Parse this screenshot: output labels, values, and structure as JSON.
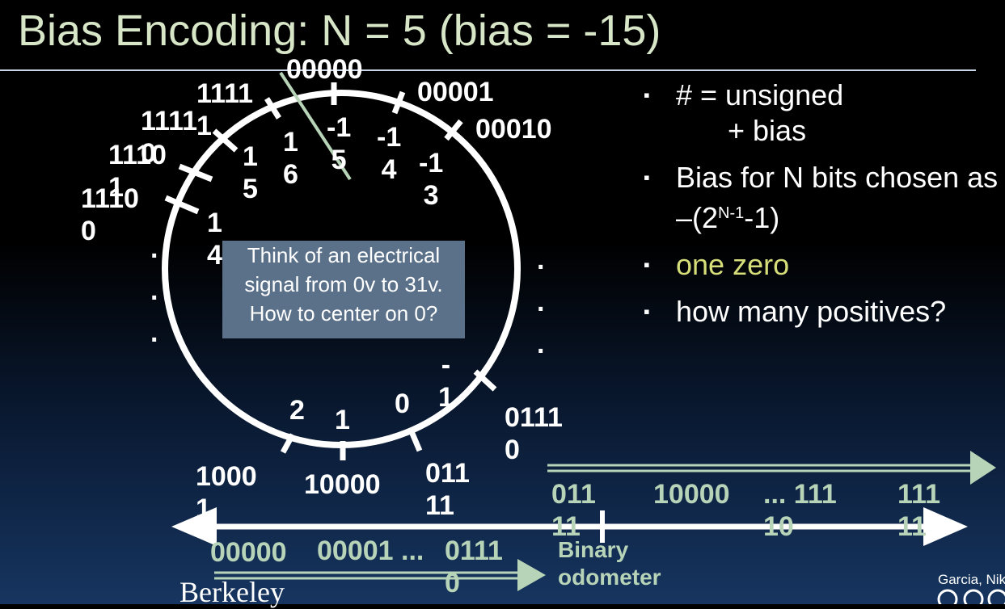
{
  "slide": {
    "title": "Bias Encoding: N = 5 (bias = -15)"
  },
  "circle_labels": {
    "b00000": "00000",
    "b00001": "00001",
    "b00010": "00010",
    "b11111": "1111\n1",
    "b11110": "1111\n0",
    "b11101": "1110\n1",
    "b11100": "1110\n0",
    "b01111": "0111\n0",
    "b10001": "1000\n1",
    "b10000": "10000",
    "b01111b": "011\n11",
    "v_m15": "-1\n5",
    "v_m14": "-1\n4",
    "v_m13": "-1\n3",
    "v_16": "1\n6",
    "v_15": "1\n5",
    "v_14": "1\n4",
    "v_13": "1\n3",
    "v_m1": "-\n1",
    "v_0": "0",
    "v_1": "1",
    "v_2": "2",
    "dots": ".\n.\n."
  },
  "callout": {
    "text": "Think of an electrical signal from 0v to 31v. How to center on 0?"
  },
  "bullets": [
    {
      "text_a": "# = unsigned",
      "text_b": "+ bias"
    },
    {
      "text_a": "Bias for N bits chosen as –(2",
      "sup": "N-1",
      "text_b": "-1)"
    },
    {
      "text": "one zero"
    },
    {
      "text": "how many positives?"
    }
  ],
  "number_line": {
    "top_labels": [
      "011\n11",
      "10000",
      "... 111\n10",
      "111\n11"
    ],
    "bottom_labels": [
      "00000",
      "00001 ...",
      "0111\n0"
    ],
    "tick_label_left_top": "1000\n1",
    "odometer": "Binary\nodometer"
  },
  "footer": {
    "logo": "Berkeley",
    "credit": "Garcia, Nik"
  },
  "colors": {
    "title": "#d8e6c8",
    "accent_green": "#b8d4b8",
    "highlight": "#d6de7a",
    "callout_bg": "#5b7189"
  }
}
